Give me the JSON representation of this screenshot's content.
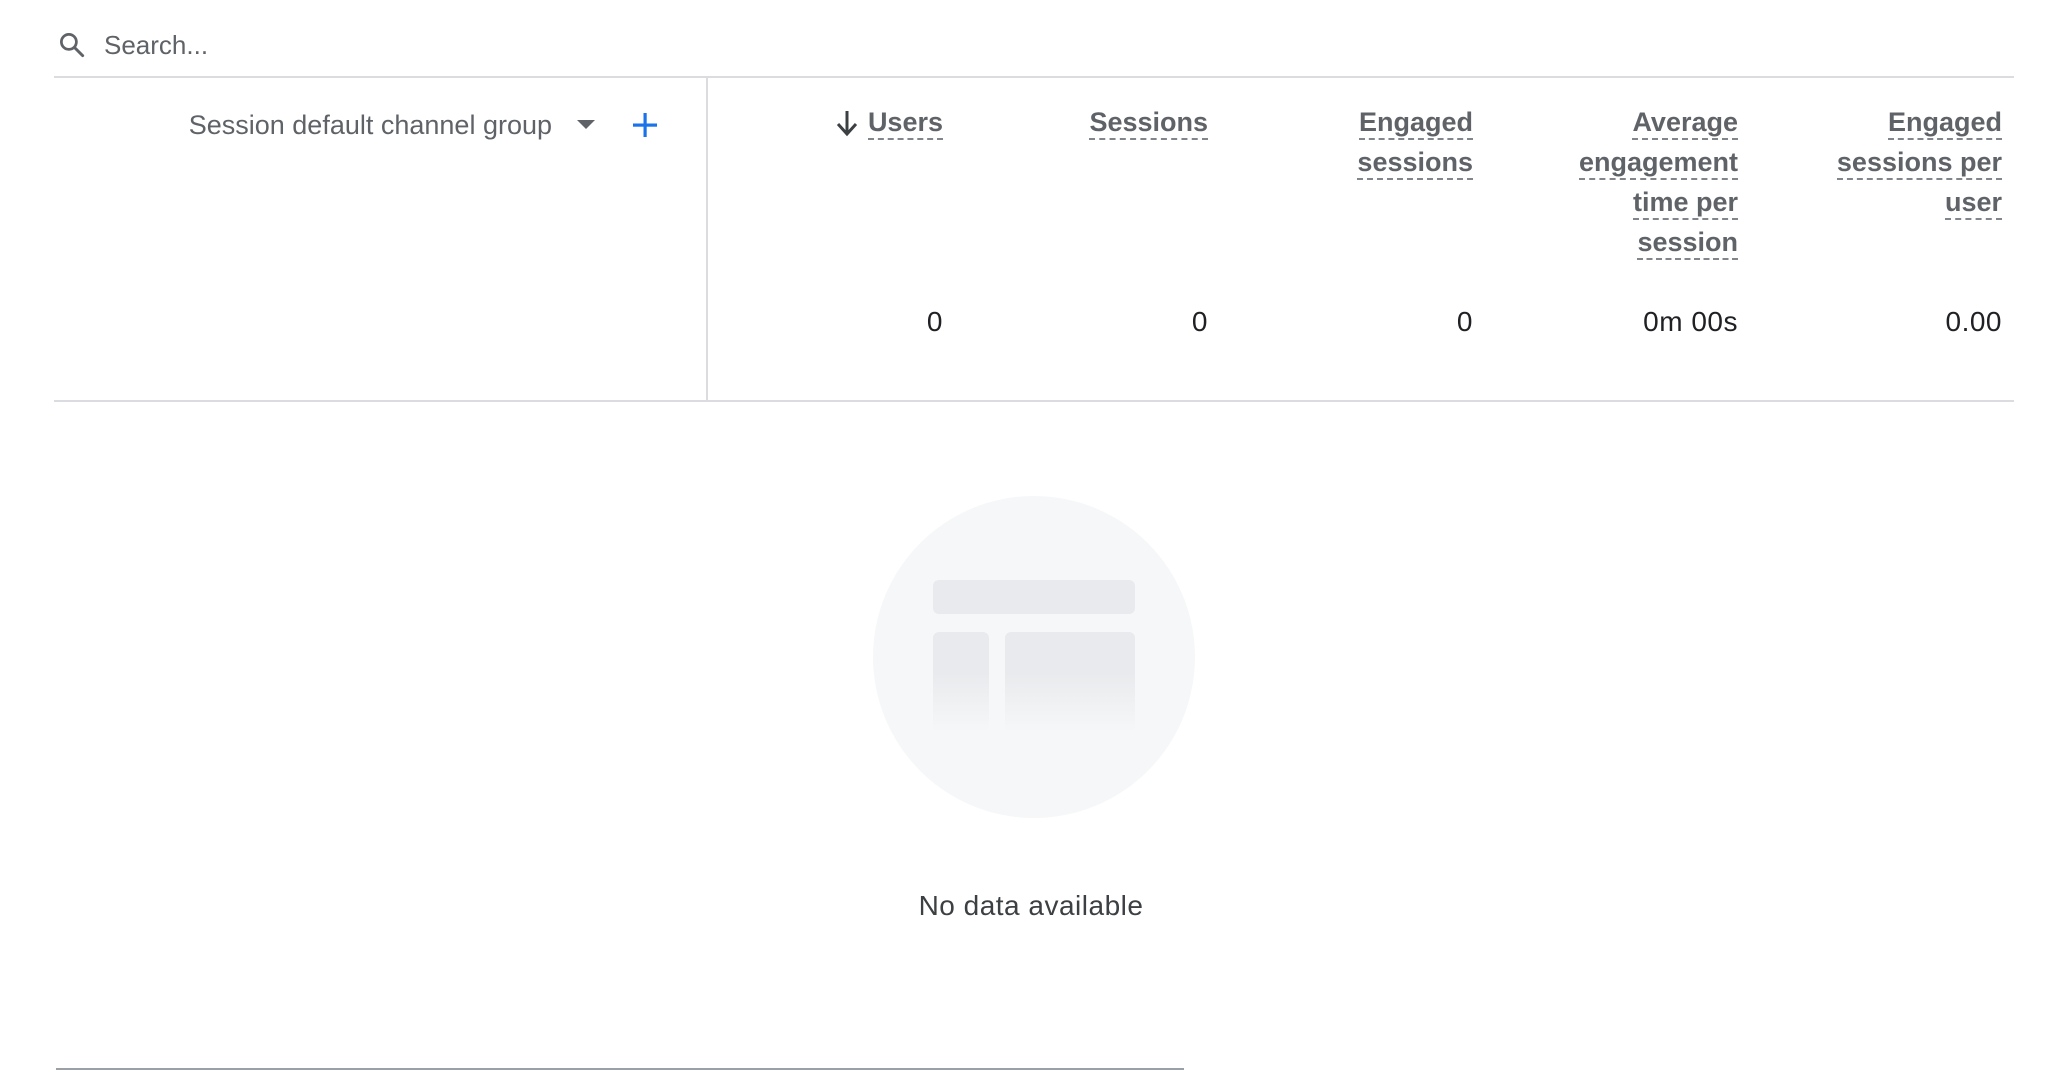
{
  "search": {
    "placeholder": "Search..."
  },
  "table": {
    "dimension": {
      "label": "Session default channel group"
    },
    "metrics": [
      {
        "id": "users",
        "lines": [
          "Users"
        ],
        "value": "0",
        "sorted": true
      },
      {
        "id": "sessions",
        "lines": [
          "Sessions"
        ],
        "value": "0",
        "sorted": false
      },
      {
        "id": "engaged-sessions",
        "lines": [
          "Engaged",
          "sessions"
        ],
        "value": "0",
        "sorted": false
      },
      {
        "id": "avg-engagement-time",
        "lines": [
          "Average",
          "engagement",
          "time per",
          "session"
        ],
        "value": "0m 00s",
        "sorted": false
      },
      {
        "id": "engaged-sessions-per-user",
        "lines": [
          "Engaged",
          "sessions per",
          "user"
        ],
        "value": "0.00",
        "sorted": false
      }
    ]
  },
  "empty_state": {
    "message": "No data available"
  },
  "colors": {
    "accent": "#1a73e8",
    "divider": "#dadce0",
    "muted_text": "#5f6368"
  },
  "icons": {
    "search": "search-icon",
    "dropdown": "arrow-drop-down-icon",
    "add": "plus-icon",
    "sort": "arrow-down-icon",
    "empty": "table-placeholder-icon"
  }
}
